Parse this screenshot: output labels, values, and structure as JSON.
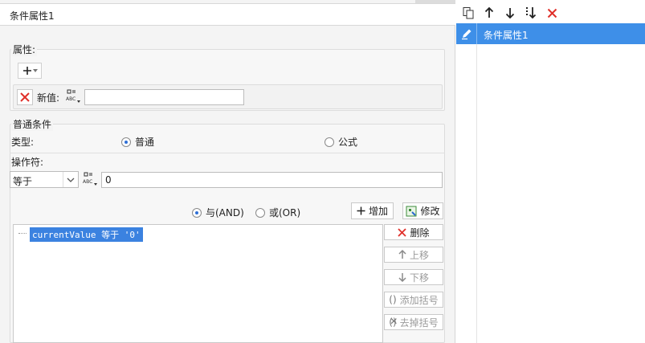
{
  "title": "条件属性1",
  "attributes": {
    "legend": "属性:",
    "add_label": "+",
    "new_value_label": "新值:",
    "new_value": ""
  },
  "condition": {
    "legend": "普通条件",
    "type_label": "类型:",
    "type_normal": "普通",
    "type_formula": "公式",
    "operator_label": "操作符:",
    "operator_value": "等于",
    "value": "0"
  },
  "logic": {
    "and_label": "与(AND)",
    "or_label": "或(OR)",
    "add_label": "增加",
    "modify_label": "修改"
  },
  "conditions_list": [
    "currentValue 等于 '0'"
  ],
  "side_buttons": {
    "delete": "删除",
    "up": "上移",
    "down": "下移",
    "add_bracket": "添加括号",
    "remove_bracket": "去掉括号"
  },
  "right_panel": {
    "items": [
      "条件属性1"
    ]
  },
  "colors": {
    "selection": "#3e8fe8",
    "delete_red": "#e0302a",
    "radio_on": "#2f6fd6"
  }
}
